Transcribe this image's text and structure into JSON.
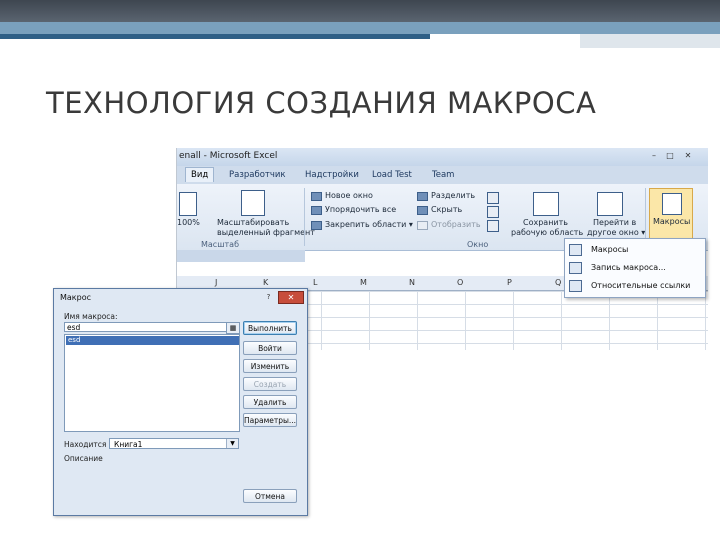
{
  "slide": {
    "title": "ТЕХНОЛОГИЯ СОЗДАНИЯ МАКРОСА"
  },
  "excel": {
    "window_title": "enall - Microsoft Excel",
    "tabs": [
      "Вид",
      "Разработчик",
      "Надстройки",
      "Load Test",
      "Team"
    ],
    "active_tab": "Вид",
    "ribbon": {
      "zoom_100": "100%",
      "zoom_selection": [
        "Масштабировать",
        "выделенный фрагмент"
      ],
      "zoom_group": "Масштаб",
      "new_window": "Новое окно",
      "arrange_all": "Упорядочить все",
      "freeze_panes": "Закрепить области ▾",
      "split": "Разделить",
      "hide": "Скрыть",
      "unhide": "Отобразить",
      "save_workspace": [
        "Сохранить",
        "рабочую область"
      ],
      "switch_windows": [
        "Перейти в",
        "другое окно ▾"
      ],
      "window_group": "Окно",
      "macros": "Макросы"
    },
    "columns": [
      "J",
      "K",
      "L",
      "M",
      "N",
      "O",
      "P",
      "Q"
    ],
    "macros_menu": [
      "Макросы",
      "Запись макроса...",
      "Относительные ссылки"
    ]
  },
  "dialog": {
    "title": "Макрос",
    "help": "?",
    "close": "✕",
    "name_label": "Имя макроса:",
    "name_value": "esd",
    "pick_icon": "▦",
    "list": [
      "esd"
    ],
    "buttons": {
      "run": "Выполнить",
      "step": "Войти",
      "edit": "Изменить",
      "create": "Создать",
      "delete": "Удалить",
      "options": "Параметры..."
    },
    "in_label": "Находится в:",
    "in_value": "Книга1",
    "description_label": "Описание",
    "cancel": "Отмена"
  }
}
